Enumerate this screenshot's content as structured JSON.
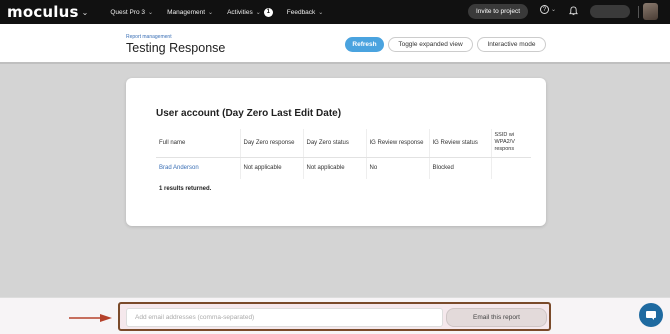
{
  "topnav": {
    "logo": "moculus",
    "items": [
      {
        "label": "Quest Pro 3"
      },
      {
        "label": "Management"
      },
      {
        "label": "Activities",
        "badge": "1"
      },
      {
        "label": "Feedback"
      }
    ],
    "invite_label": "Invite to project",
    "help_glyph": "?"
  },
  "header": {
    "breadcrumb": "Report management",
    "title": "Testing Response",
    "buttons": {
      "refresh": "Refresh",
      "toggle": "Toggle expanded view",
      "interactive": "Interactive mode"
    }
  },
  "report": {
    "title": "User account (Day Zero Last Edit Date)",
    "columns": [
      "Full name",
      "Day Zero response",
      "Day Zero status",
      "IG Review response",
      "IG Review status",
      "SSID wi WPA2/V respons"
    ],
    "rows": [
      [
        "Brad Anderson",
        "Not applicable",
        "Not applicable",
        "No",
        "Blocked",
        ""
      ]
    ],
    "results_text": "1 results returned."
  },
  "email_bar": {
    "placeholder": "Add email addresses (comma-separated)",
    "value": "",
    "button": "Email this report"
  },
  "colors": {
    "accent": "#4aa3df",
    "link": "#3a6fb5",
    "annotation": "#7a4a2a",
    "arrow": "#b5412b"
  },
  "icons": [
    "chevron-down-icon",
    "help-icon",
    "bell-icon",
    "chat-icon",
    "arrow-right-icon"
  ]
}
